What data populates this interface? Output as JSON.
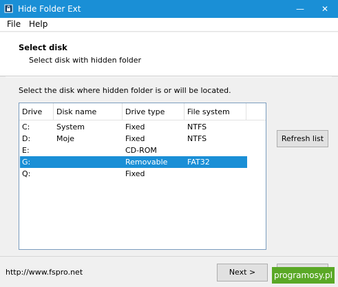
{
  "window": {
    "title": "Hide Folder Ext",
    "minimize_glyph": "—",
    "close_glyph": "✕"
  },
  "menu": [
    {
      "label": "File"
    },
    {
      "label": "Help"
    }
  ],
  "header": {
    "title": "Select disk",
    "subtitle": "Select disk with hidden folder"
  },
  "instruction": "Select the disk where hidden folder is or will be located.",
  "disk_list": {
    "columns": [
      "Drive",
      "Disk name",
      "Drive type",
      "File system"
    ],
    "rows": [
      {
        "drive": "C:",
        "disk_name": "System",
        "drive_type": "Fixed",
        "file_system": "NTFS",
        "selected": false
      },
      {
        "drive": "D:",
        "disk_name": "Moje",
        "drive_type": "Fixed",
        "file_system": "NTFS",
        "selected": false
      },
      {
        "drive": "E:",
        "disk_name": "",
        "drive_type": "CD-ROM",
        "file_system": "",
        "selected": false
      },
      {
        "drive": "G:",
        "disk_name": "",
        "drive_type": "Removable",
        "file_system": "FAT32",
        "selected": true
      },
      {
        "drive": "Q:",
        "disk_name": "",
        "drive_type": "Fixed",
        "file_system": "",
        "selected": false
      }
    ]
  },
  "buttons": {
    "refresh": "Refresh list",
    "next": "Next >",
    "cancel": ""
  },
  "footer": {
    "url": "http://www.fspro.net"
  },
  "watermark": "programosy.pl",
  "colors": {
    "titlebar": "#1a8fd6",
    "selection": "#1a8fd6",
    "watermark": "#5aa826"
  }
}
